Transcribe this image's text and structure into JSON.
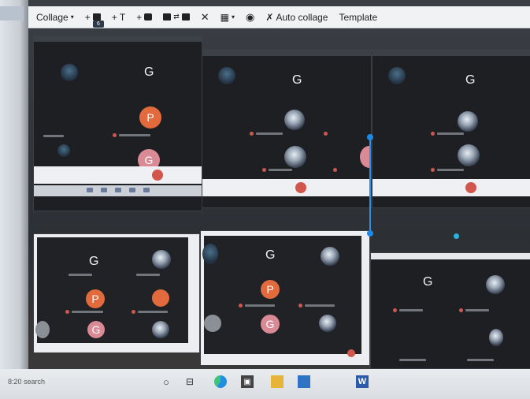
{
  "toolbar": {
    "collage_label": "Collage",
    "add_image_label": "+",
    "image_count": "6",
    "add_text_label": "+ T",
    "add_sticker_label": "+",
    "auto_collage_label": "Auto collage",
    "template_label": "Template"
  },
  "panels": {
    "tile_letter": "G",
    "avatar_p": "P",
    "avatar_g": "G"
  },
  "taskbar": {
    "clock_text": "8:20 search"
  },
  "colors": {
    "toolbar_bg": "#f1f2f4",
    "meeting_bg": "#1d1f22",
    "avatar_orange": "#e26a3d",
    "avatar_pink": "#d98a95",
    "end_call_red": "#d2564c",
    "selection_blue": "#2f8ee3"
  },
  "icons": {
    "collage": "chevron-down-icon",
    "image": "image-icon",
    "swap": "swap-icon",
    "shuffle": "shuffle-icon",
    "grid": "grid-icon",
    "preview": "eye-icon",
    "auto_collage": "magic-wand-icon"
  }
}
